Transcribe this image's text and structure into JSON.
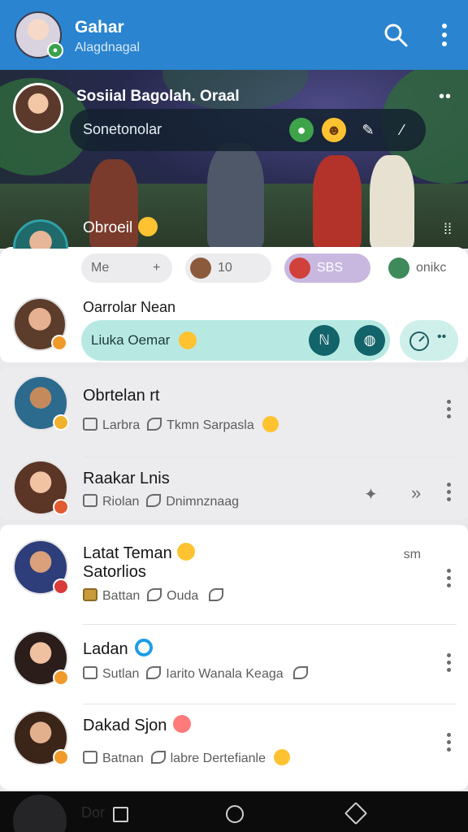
{
  "appbar": {
    "title": "Gahar",
    "subtitle": "Alagdnagal",
    "search_icon": "search-icon",
    "more_icon": "more-vert-icon",
    "color": "#2a84cf"
  },
  "hero": {
    "title": "Sosiial Bagolah. Oraal",
    "more": "••",
    "pill_text": "Sonetonolar",
    "talker_label": "Obroeil",
    "talker_more": "⁞⁞"
  },
  "stories": {
    "chips": [
      {
        "label": "Me",
        "extra": "+"
      },
      {
        "label": "10"
      },
      {
        "label": "SBS"
      },
      {
        "label": "onikc"
      }
    ]
  },
  "reply": {
    "name": "Oarrolar Nean",
    "text": "Liuka Oemar"
  },
  "group1": [
    {
      "name": "Obrtelan rt",
      "sub_a": "Larbra",
      "sub_b": "Tkmn Sarpasla"
    },
    {
      "name": "Raakar Lnis",
      "sub_a": "Riolan",
      "sub_b": "Dnimnznaag"
    }
  ],
  "group2": [
    {
      "name": "Latat Teman",
      "name2": "Satorlios",
      "sub_a": "Battan",
      "sub_b": "Ouda",
      "time": "sm"
    },
    {
      "name": "Ladan",
      "sub_a": "Sutlan",
      "sub_b": "Iarito Wanala Keaga"
    },
    {
      "name": "Dakad Sjon",
      "sub_a": "Batnan",
      "sub_b": "labre Dertefianle"
    }
  ],
  "navbar": {
    "ghost_text": "Dor"
  }
}
